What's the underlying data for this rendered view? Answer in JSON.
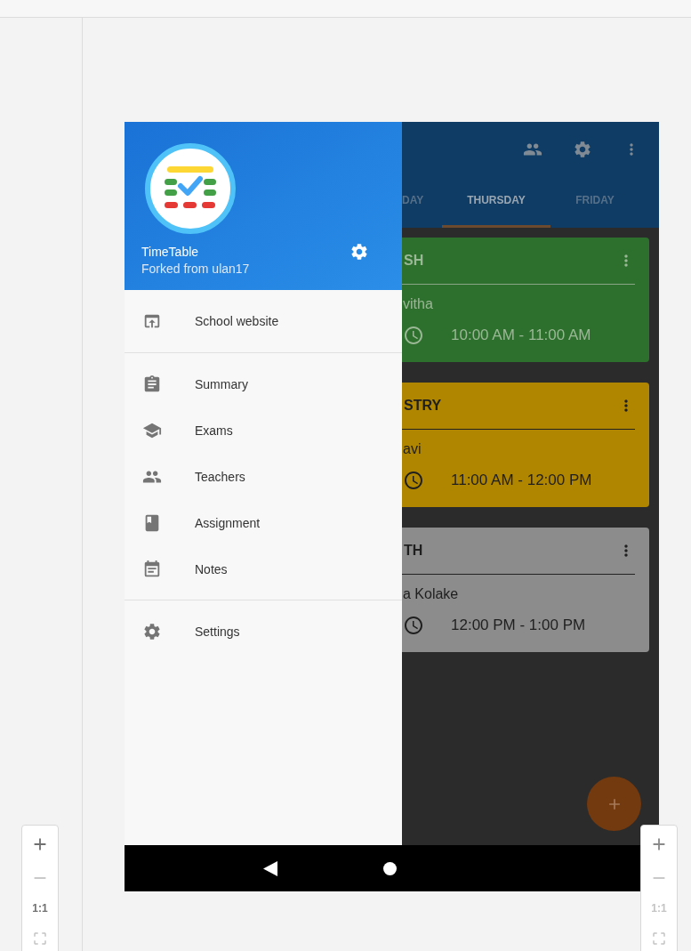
{
  "drawer": {
    "app_name": "TimeTable",
    "subtitle": "Forked from ulan17",
    "sections": [
      [
        {
          "label": "School website"
        }
      ],
      [
        {
          "label": "Summary"
        },
        {
          "label": "Exams"
        },
        {
          "label": "Teachers"
        },
        {
          "label": "Assignment"
        },
        {
          "label": "Notes"
        }
      ],
      [
        {
          "label": "Settings"
        }
      ]
    ]
  },
  "app_bar": {
    "tabs": [
      {
        "label": "DAY",
        "selected": false
      },
      {
        "label": "THURSDAY",
        "selected": true
      },
      {
        "label": "FRIDAY",
        "selected": false
      }
    ]
  },
  "cards": [
    {
      "subject": "SH",
      "teacher": "vitha",
      "time": "10:00 AM - 11:00 AM",
      "color": "#2d6f2c"
    },
    {
      "subject": "STRY",
      "teacher": "avi",
      "time": "11:00 AM - 12:00 PM",
      "color": "#b08600"
    },
    {
      "subject": "TH",
      "teacher": "a Kolake",
      "time": "12:00 PM - 1:00 PM",
      "color": "#8c8c8c"
    }
  ],
  "zoom_controls": [
    {
      "ratio_label": "1:1",
      "disabled": false
    },
    {
      "ratio_label": "1:1",
      "disabled": true
    }
  ]
}
